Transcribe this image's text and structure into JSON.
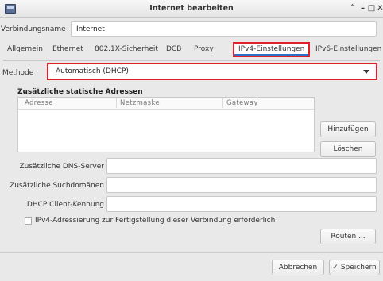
{
  "window": {
    "title": "Internet bearbeiten",
    "controls": {
      "minimize": "˄",
      "restore": "–",
      "maximize": "□",
      "close": "✕"
    }
  },
  "connection": {
    "label": "Verbindungsname",
    "value": "Internet"
  },
  "tabs": [
    {
      "label": "Allgemein"
    },
    {
      "label": "Ethernet"
    },
    {
      "label": "802.1X-Sicherheit"
    },
    {
      "label": "DCB"
    },
    {
      "label": "Proxy"
    },
    {
      "label": "IPv4-Einstellungen",
      "active": true
    },
    {
      "label": "IPv6-Einstellungen"
    }
  ],
  "method": {
    "label": "Methode",
    "value": "Automatisch (DHCP)"
  },
  "static_addresses": {
    "title": "Zusätzliche statische Adressen",
    "columns": [
      "Adresse",
      "Netzmaske",
      "Gateway"
    ],
    "rows": [],
    "add_label": "Hinzufügen",
    "delete_label": "Löschen"
  },
  "fields": {
    "dns": {
      "label": "Zusätzliche DNS-Server",
      "value": ""
    },
    "search": {
      "label": "Zusätzliche Suchdomänen",
      "value": ""
    },
    "dhcp_id": {
      "label": "DHCP Client-Kennung",
      "value": ""
    }
  },
  "require_ipv4": {
    "label": "IPv4-Adressierung zur Fertigstellung dieser Verbindung erforderlich",
    "checked": false
  },
  "routes_label": "Routen ...",
  "footer": {
    "cancel_label": "Abbrechen",
    "save_label": "Speichern",
    "save_icon": "✓"
  },
  "colors": {
    "highlight": "#e0202a",
    "active_tab_underline": "#2f6fc9"
  }
}
